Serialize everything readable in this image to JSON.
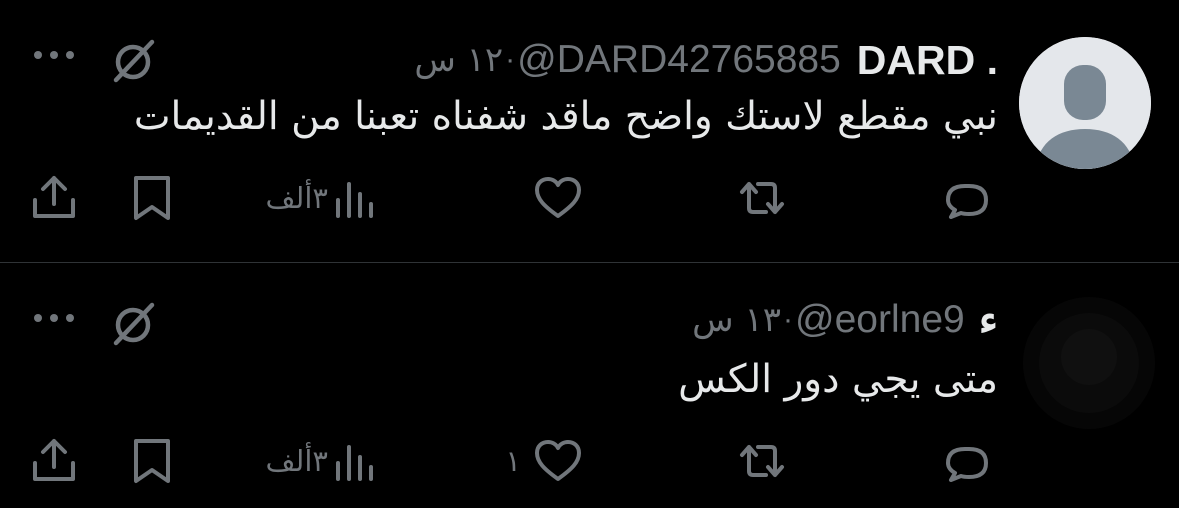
{
  "tweets": [
    {
      "display_name": "DARD .",
      "handle": "@DARD42765885",
      "separator": "·",
      "time": "١٢ س",
      "text": "نبي مقطع لاستك واضح ماقد شفناه تعبنا من القديمات",
      "likes": "",
      "views": "٣ألف",
      "avatar": "default-avatar-icon"
    },
    {
      "display_name": "ء",
      "handle": "@eorlne9",
      "separator": "·",
      "time": "١٣ س",
      "text": "متى يجي دور الكس",
      "likes": "١",
      "views": "٣ألف",
      "avatar": "dark-photo-avatar"
    }
  ],
  "colors": {
    "background": "#000000",
    "primary_text": "#e7e9ea",
    "secondary_text": "#71767b",
    "divider": "#2f3336",
    "default_avatar_bg": "#e4e7eb",
    "default_avatar_fg": "#7a8894"
  },
  "icons": [
    "more-icon",
    "grok-icon",
    "reply-icon",
    "retweet-icon",
    "like-icon",
    "views-icon",
    "bookmark-icon",
    "share-icon"
  ]
}
